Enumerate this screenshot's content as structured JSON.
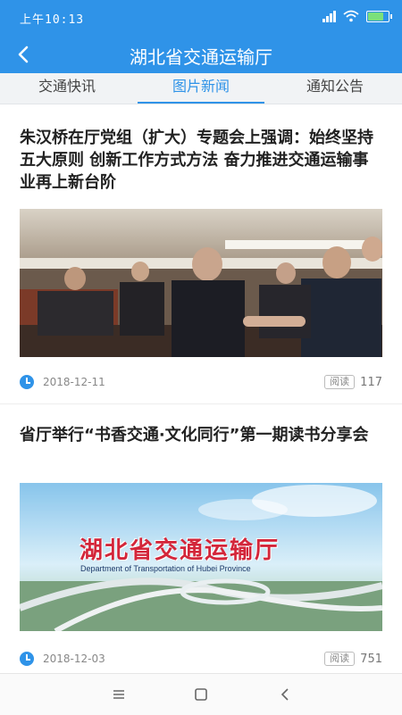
{
  "status_bar": {
    "time": "上午10:13",
    "signal_icon": "signal-icon",
    "wifi_icon": "wifi-icon",
    "battery_icon": "battery-icon"
  },
  "header": {
    "title": "湖北省交通运输厅",
    "back_icon": "chevron-left-icon"
  },
  "tabs": [
    {
      "label": "交通快讯",
      "active": false
    },
    {
      "label": "图片新闻",
      "active": true
    },
    {
      "label": "通知公告",
      "active": false
    }
  ],
  "articles": [
    {
      "title": "朱汉桥在厅党组（扩大）专题会上强调：始终坚持五大原则 创新工作方式方法 奋力推进交通运输事业再上新台阶",
      "image": "meeting-handshake-photo",
      "date": "2018-12-11",
      "read_label": "阅读",
      "count": "117"
    },
    {
      "title": "省厅举行“书香交通·文化同行”第一期读书分享会",
      "image": "department-banner-photo",
      "banner_text": "湖北省交通运输厅",
      "banner_subtext": "Department of Transportation of Hubei Province",
      "date": "2018-12-03",
      "read_label": "阅读",
      "count": "751"
    }
  ],
  "nav": {
    "menu_icon": "menu-icon",
    "home_icon": "home-icon",
    "back_icon": "back-icon"
  },
  "colors": {
    "primary": "#2f93e8",
    "tab_bg": "#f1f3f5",
    "banner_red": "#d3263a"
  }
}
